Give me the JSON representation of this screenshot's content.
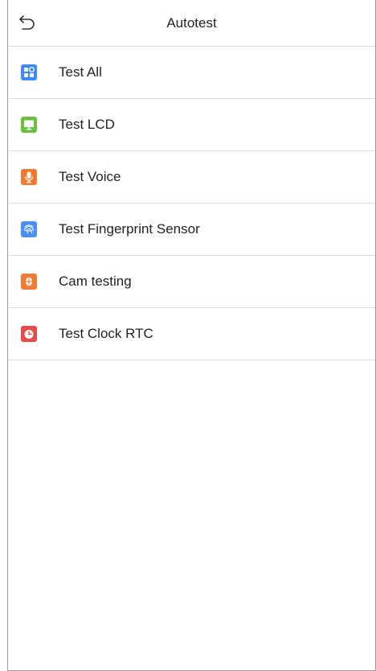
{
  "header": {
    "title": "Autotest",
    "back_icon": "back-arrow-icon"
  },
  "menu": {
    "items": [
      {
        "label": "Test All",
        "icon": "grid-icon",
        "color": "#3d8af7"
      },
      {
        "label": "Test LCD",
        "icon": "monitor-icon",
        "color": "#6abf3c"
      },
      {
        "label": "Test Voice",
        "icon": "microphone-icon",
        "color": "#f07c33"
      },
      {
        "label": "Test Fingerprint Sensor",
        "icon": "fingerprint-icon",
        "color": "#4a8ff2"
      },
      {
        "label": "Cam testing",
        "icon": "face-icon",
        "color": "#f07c33"
      },
      {
        "label": "Test Clock RTC",
        "icon": "clock-icon",
        "color": "#ea4a4a"
      }
    ]
  }
}
